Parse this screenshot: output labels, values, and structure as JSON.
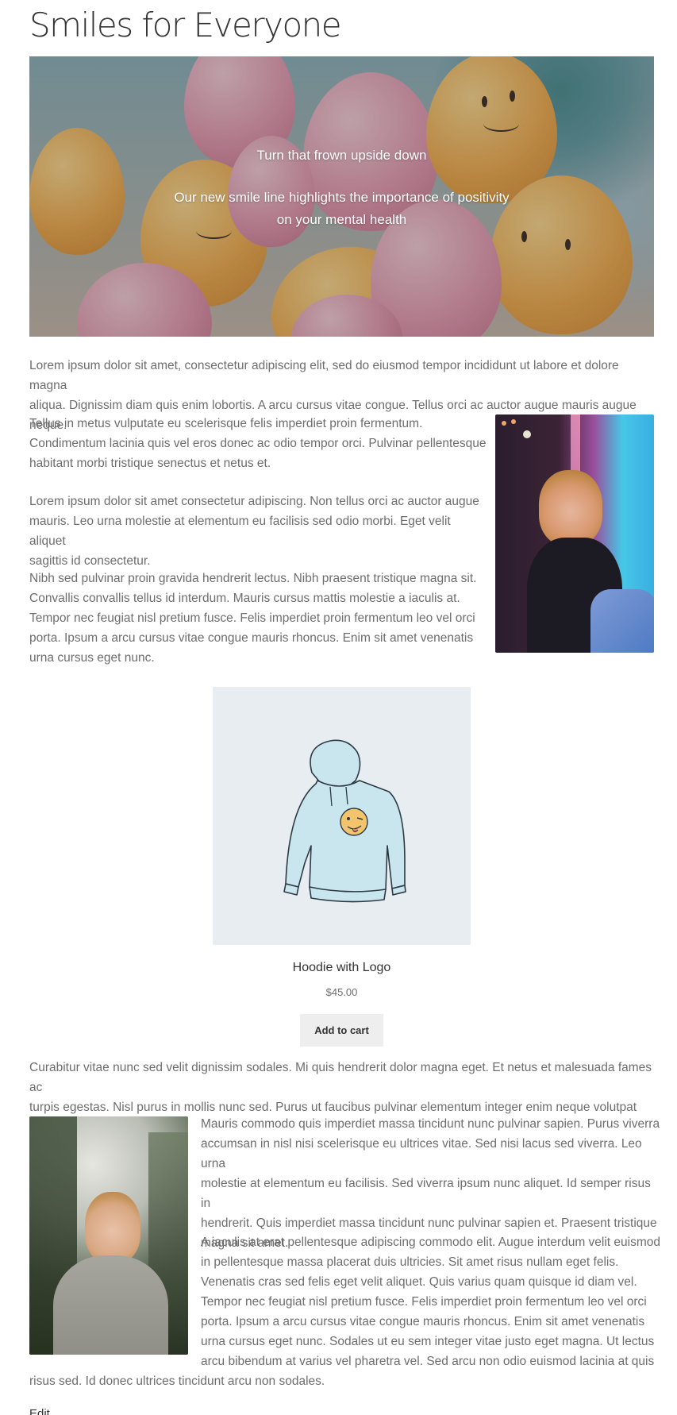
{
  "page": {
    "title": "Smiles for Everyone",
    "edit_label": "Edit"
  },
  "hero": {
    "heading": "Turn that frown upside down",
    "subheading_line1": "Our new smile line highlights the importance of positivity",
    "subheading_line2": "on your mental health"
  },
  "content": {
    "intro_line1": "Lorem ipsum dolor sit amet, consectetur adipiscing elit, sed do eiusmod tempor incididunt ut labore et dolore magna",
    "intro_line2": "aliqua. Dignissim diam quis enim lobortis. A arcu cursus vitae congue. Tellus orci ac auctor augue mauris augue neque.",
    "p2_lines": [
      "Tellus in metus vulputate eu scelerisque felis imperdiet proin fermentum.",
      "Condimentum lacinia quis vel eros donec ac odio tempor orci. Pulvinar pellentesque",
      "habitant morbi tristique senectus et netus et."
    ],
    "p3_lines": [
      "Lorem ipsum dolor sit amet consectetur adipiscing. Non tellus orci ac auctor augue",
      "mauris. Leo urna molestie at elementum eu facilisis sed odio morbi. Eget velit aliquet",
      "sagittis id consectetur."
    ],
    "p4_lines": [
      "Nibh sed pulvinar proin gravida hendrerit lectus. Nibh praesent tristique magna sit.",
      "Convallis convallis tellus id interdum. Mauris cursus mattis molestie a iaculis at.",
      "Tempor nec feugiat nisl pretium fusce. Felis imperdiet proin fermentum leo vel orci",
      "porta. Ipsum a arcu cursus vitae congue mauris rhoncus. Enim sit amet venenatis",
      "urna cursus eget nunc."
    ],
    "p5_lines": [
      "Curabitur vitae nunc sed velit dignissim sodales. Mi quis hendrerit dolor magna eget. Et netus et malesuada fames ac",
      "turpis egestas. Nisl purus in mollis nunc sed. Purus ut faucibus pulvinar elementum integer enim neque volutpat ac."
    ],
    "p6_lines": [
      "Mauris commodo quis imperdiet massa tincidunt nunc pulvinar sapien. Purus viverra",
      "accumsan in nisl nisi scelerisque eu ultrices vitae. Sed nisi lacus sed viverra. Leo urna",
      "molestie at elementum eu facilisis. Sed viverra ipsum nunc aliquet. Id semper risus in",
      "hendrerit. Quis imperdiet massa tincidunt nunc pulvinar sapien et. Praesent tristique",
      "magna sit amet."
    ],
    "p7_lines": [
      "A iaculis at erat pellentesque adipiscing commodo elit. Augue interdum velit euismod",
      "in pellentesque massa placerat duis ultricies. Sit amet risus nullam eget felis.",
      "Venenatis cras sed felis eget velit aliquet. Quis varius quam quisque id diam vel.",
      "Tempor nec feugiat nisl pretium fusce. Felis imperdiet proin fermentum leo vel orci",
      "porta. Ipsum a arcu cursus vitae congue mauris rhoncus. Enim sit amet venenatis",
      "urna cursus eget nunc. Sodales ut eu sem integer vitae justo eget magna. Ut lectus",
      "arcu bibendum at varius vel pharetra vel. Sed arcu non odio euismod lacinia at quis"
    ],
    "p7_last_line": "risus sed. Id donec ultrices tincidunt arcu non sodales."
  },
  "product": {
    "title": "Hoodie with Logo",
    "price": "$45.00",
    "button_label": "Add to cart"
  }
}
